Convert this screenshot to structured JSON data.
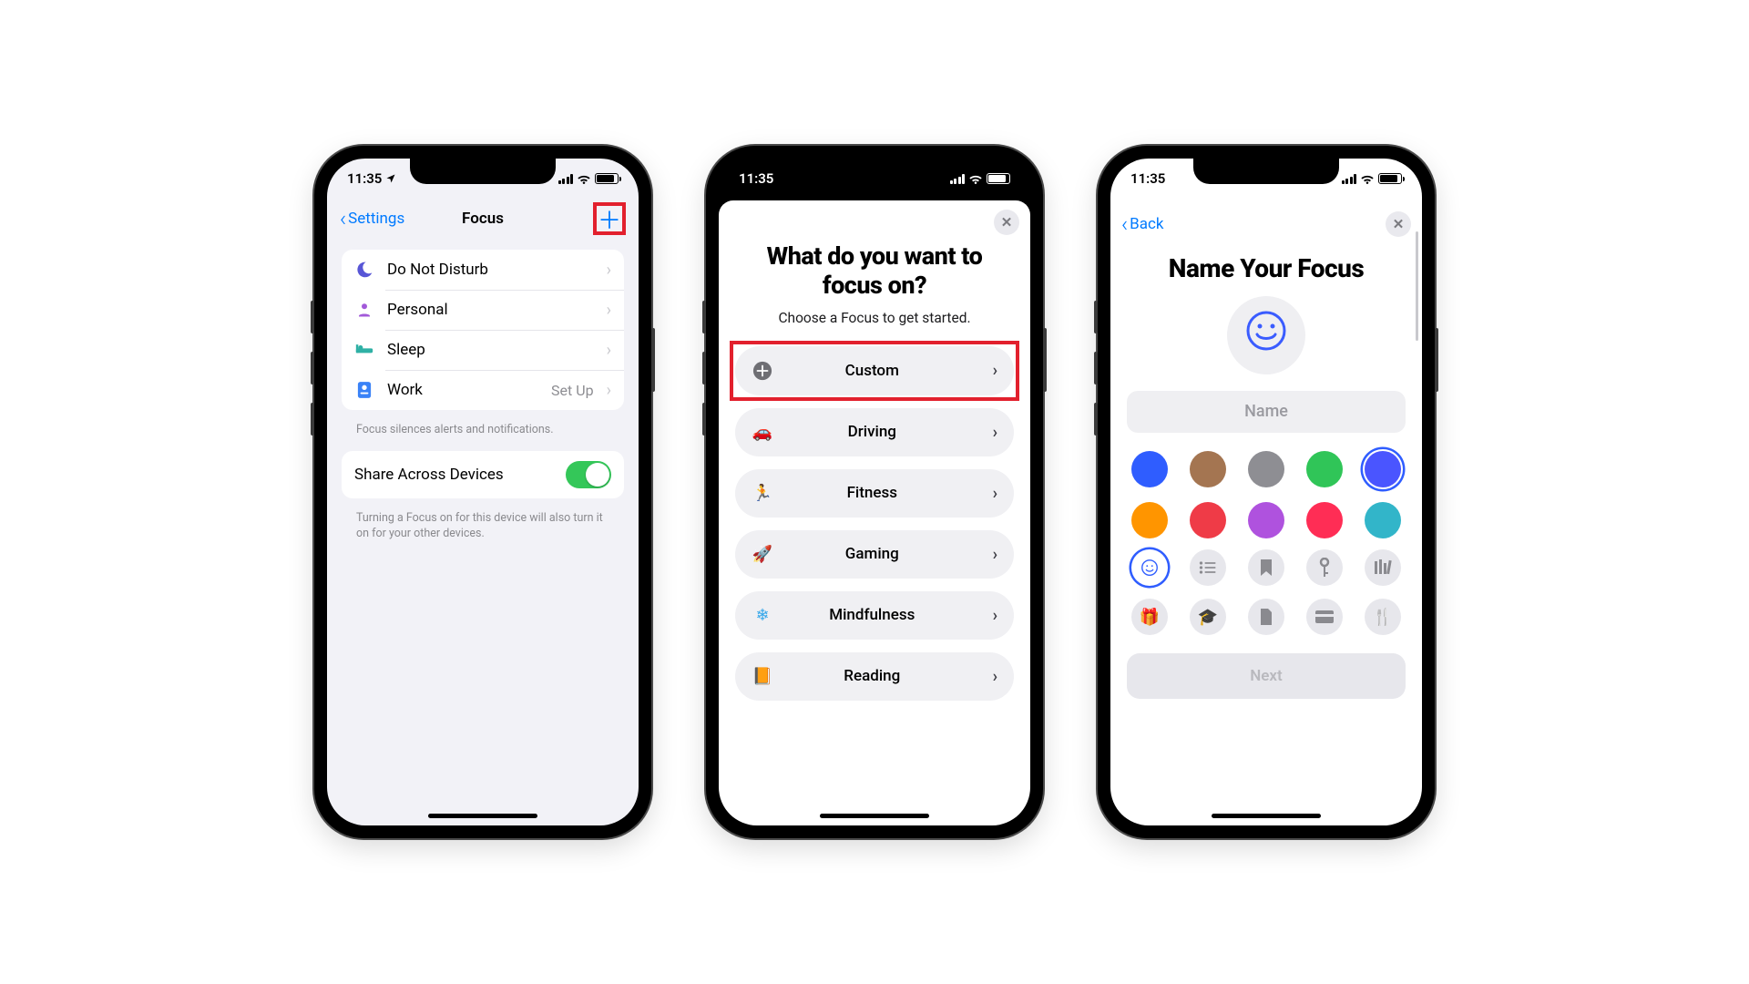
{
  "status": {
    "time": "11:35"
  },
  "phone1": {
    "back": "Settings",
    "title": "Focus",
    "focus_items": [
      {
        "label": "Do Not Disturb",
        "icon": "moon",
        "color": "#5856d6"
      },
      {
        "label": "Personal",
        "icon": "person",
        "color": "#a259d9"
      },
      {
        "label": "Sleep",
        "icon": "bed",
        "color": "#2fb0a5"
      },
      {
        "label": "Work",
        "icon": "badge",
        "color": "#3a82f7",
        "detail": "Set Up"
      }
    ],
    "focus_note": "Focus silences alerts and notifications.",
    "share_label": "Share Across Devices",
    "share_note": "Turning a Focus on for this device will also turn it on for your other devices."
  },
  "phone2": {
    "title": "What do you want to focus on?",
    "subtitle": "Choose a Focus to get started.",
    "options": [
      {
        "label": "Custom",
        "icon": "plus",
        "color": "#6e6e73",
        "highlighted": true
      },
      {
        "label": "Driving",
        "icon": "car",
        "color": "#2f6bd6"
      },
      {
        "label": "Fitness",
        "icon": "run",
        "color": "#30b24a"
      },
      {
        "label": "Gaming",
        "icon": "rocket",
        "color": "#1e7ff0"
      },
      {
        "label": "Mindfulness",
        "icon": "flower",
        "color": "#36a7ea"
      },
      {
        "label": "Reading",
        "icon": "book",
        "color": "#f28a1e"
      }
    ]
  },
  "phone3": {
    "back": "Back",
    "title": "Name Your Focus",
    "name_placeholder": "Name",
    "colors": [
      {
        "hex": "#2f5dff"
      },
      {
        "hex": "#a47551"
      },
      {
        "hex": "#8e8e93"
      },
      {
        "hex": "#30c558"
      },
      {
        "hex": "#4a55ff",
        "selected": true
      },
      {
        "hex": "#ff9500"
      },
      {
        "hex": "#ef3b47"
      },
      {
        "hex": "#af52de"
      },
      {
        "hex": "#ff2d55"
      },
      {
        "hex": "#32b5c9"
      }
    ],
    "glyphs": [
      {
        "name": "smile",
        "selected": true
      },
      {
        "name": "list"
      },
      {
        "name": "bookmark"
      },
      {
        "name": "key"
      },
      {
        "name": "library"
      },
      {
        "name": "gift"
      },
      {
        "name": "graduation"
      },
      {
        "name": "document"
      },
      {
        "name": "card"
      },
      {
        "name": "dining"
      }
    ],
    "next_label": "Next"
  }
}
